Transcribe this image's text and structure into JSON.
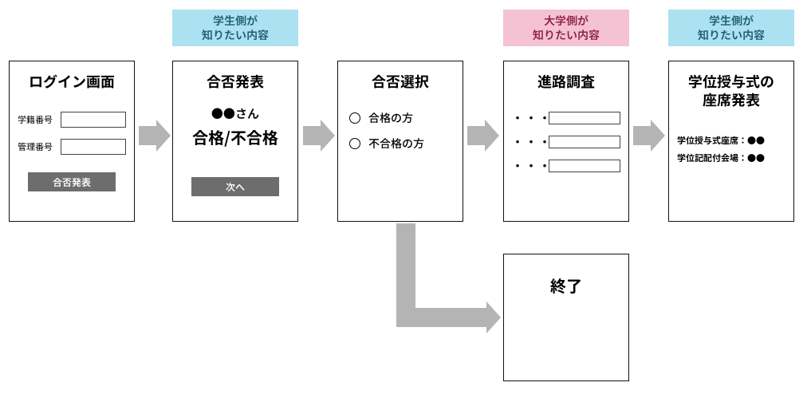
{
  "tags": {
    "tag1": "学生側が\n知りたい内容",
    "tag2": "大学側が\n知りたい内容",
    "tag3": "学生側が\n知りたい内容"
  },
  "screens": {
    "login": {
      "title": "ログイン画面",
      "field1": "学籍番号",
      "field2": "管理番号",
      "button": "合否発表"
    },
    "result": {
      "title": "合否発表",
      "name_line": "●●さん",
      "status_line": "合格/不合格",
      "button": "次へ"
    },
    "choice": {
      "title": "合否選択",
      "opt1": "合格の方",
      "opt2": "不合格の方"
    },
    "survey": {
      "title": "進路調査",
      "dots": "・・・"
    },
    "seat": {
      "title": "学位授与式の\n座席発表",
      "row1": "学位授与式座席：●●",
      "row2": "学位記配付会場：●●"
    },
    "end": {
      "title": "終了"
    }
  }
}
